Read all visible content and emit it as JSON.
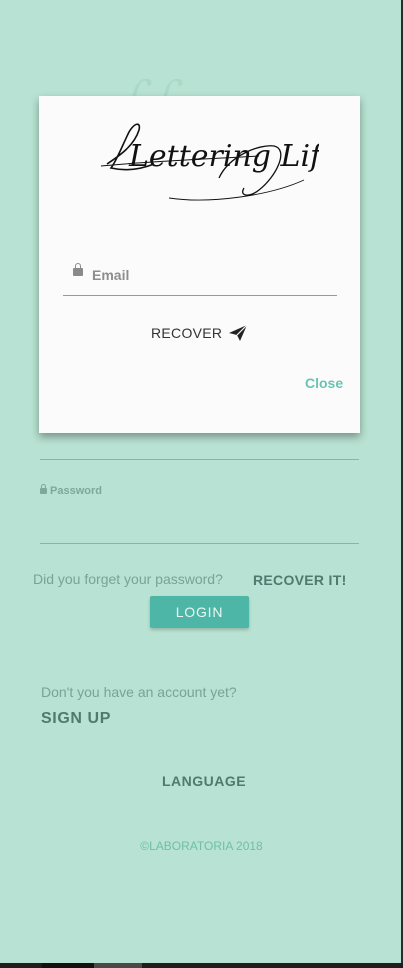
{
  "app": {
    "name": "Lettering Life"
  },
  "modal": {
    "logo_text": "Lettering Life",
    "email": {
      "placeholder": "Email",
      "value": ""
    },
    "recover_label": "RECOVER",
    "close_label": "Close"
  },
  "login_form": {
    "password_label": "Password",
    "forgot_text": "Did you forget your password?",
    "recover_it_label": "RECOVER IT!",
    "login_label": "LOGIN"
  },
  "signup": {
    "prompt": "Don't you have an account yet?",
    "label": "SIGN UP"
  },
  "language_label": "LANGUAGE",
  "footer": {
    "copyright": "©LABORATORIA 2018"
  },
  "colors": {
    "background": "#b8e2d3",
    "accent": "#4db6a7",
    "link": "#6cc3b1",
    "text_dark": "#4f7a6d"
  },
  "icons": {
    "lock": "lock-icon",
    "send": "paper-plane-icon"
  }
}
